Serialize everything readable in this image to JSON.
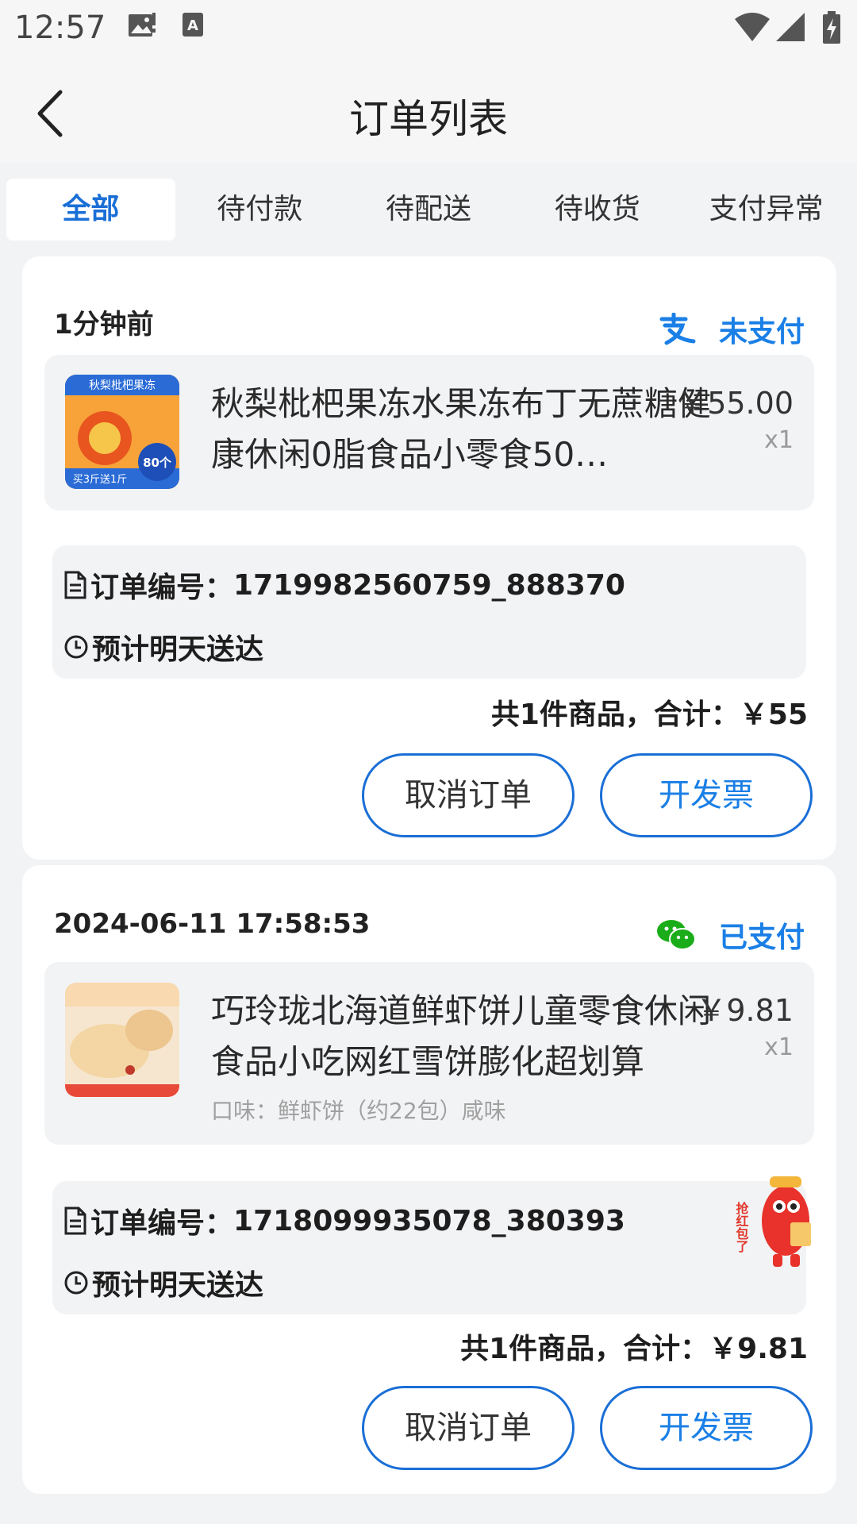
{
  "status_bar": {
    "time": "12:57"
  },
  "header": {
    "title": "订单列表"
  },
  "tabs": [
    "全部",
    "待付款",
    "待配送",
    "待收货",
    "支付异常"
  ],
  "orders": [
    {
      "time": "1分钟前",
      "pay_method_icon": "alipay-icon",
      "status": "未支付",
      "product": {
        "name": "秋梨枇杷果冻水果冻布丁无蔗糖健康休闲0脂食品小零食50…",
        "price": "￥55.00",
        "qty": "x1",
        "spec": "",
        "image_text_top": "秋梨枇杷果冻",
        "image_text_badge": "80个",
        "image_text_bottom": "买3斤送1斤"
      },
      "order_no_label": "订单编号：",
      "order_no": "1719982560759_888370",
      "delivery": "预计明天送达",
      "total": "共1件商品，合计：￥55",
      "cancel_label": "取消订单",
      "invoice_label": "开发票"
    },
    {
      "time": "2024-06-11 17:58:53",
      "pay_method_icon": "wechat-pay-icon",
      "status": "已支付",
      "product": {
        "name": "巧玲珑北海道鲜虾饼儿童零食休闲食品小吃网红雪饼膨化超划算",
        "price": "￥9.81",
        "qty": "x1",
        "spec": "口味：鲜虾饼（约22包）咸味"
      },
      "order_no_label": "订单编号：",
      "order_no": "1718099935078_380393",
      "delivery": "预计明天送达",
      "total": "共1件商品，合计：￥9.81",
      "cancel_label": "取消订单",
      "invoice_label": "开发票",
      "promo_text": "抢红包了"
    }
  ],
  "colors": {
    "accent": "#1a6fd6",
    "status_blue": "#1a7fe6",
    "page_bg": "#f2f3f5"
  }
}
